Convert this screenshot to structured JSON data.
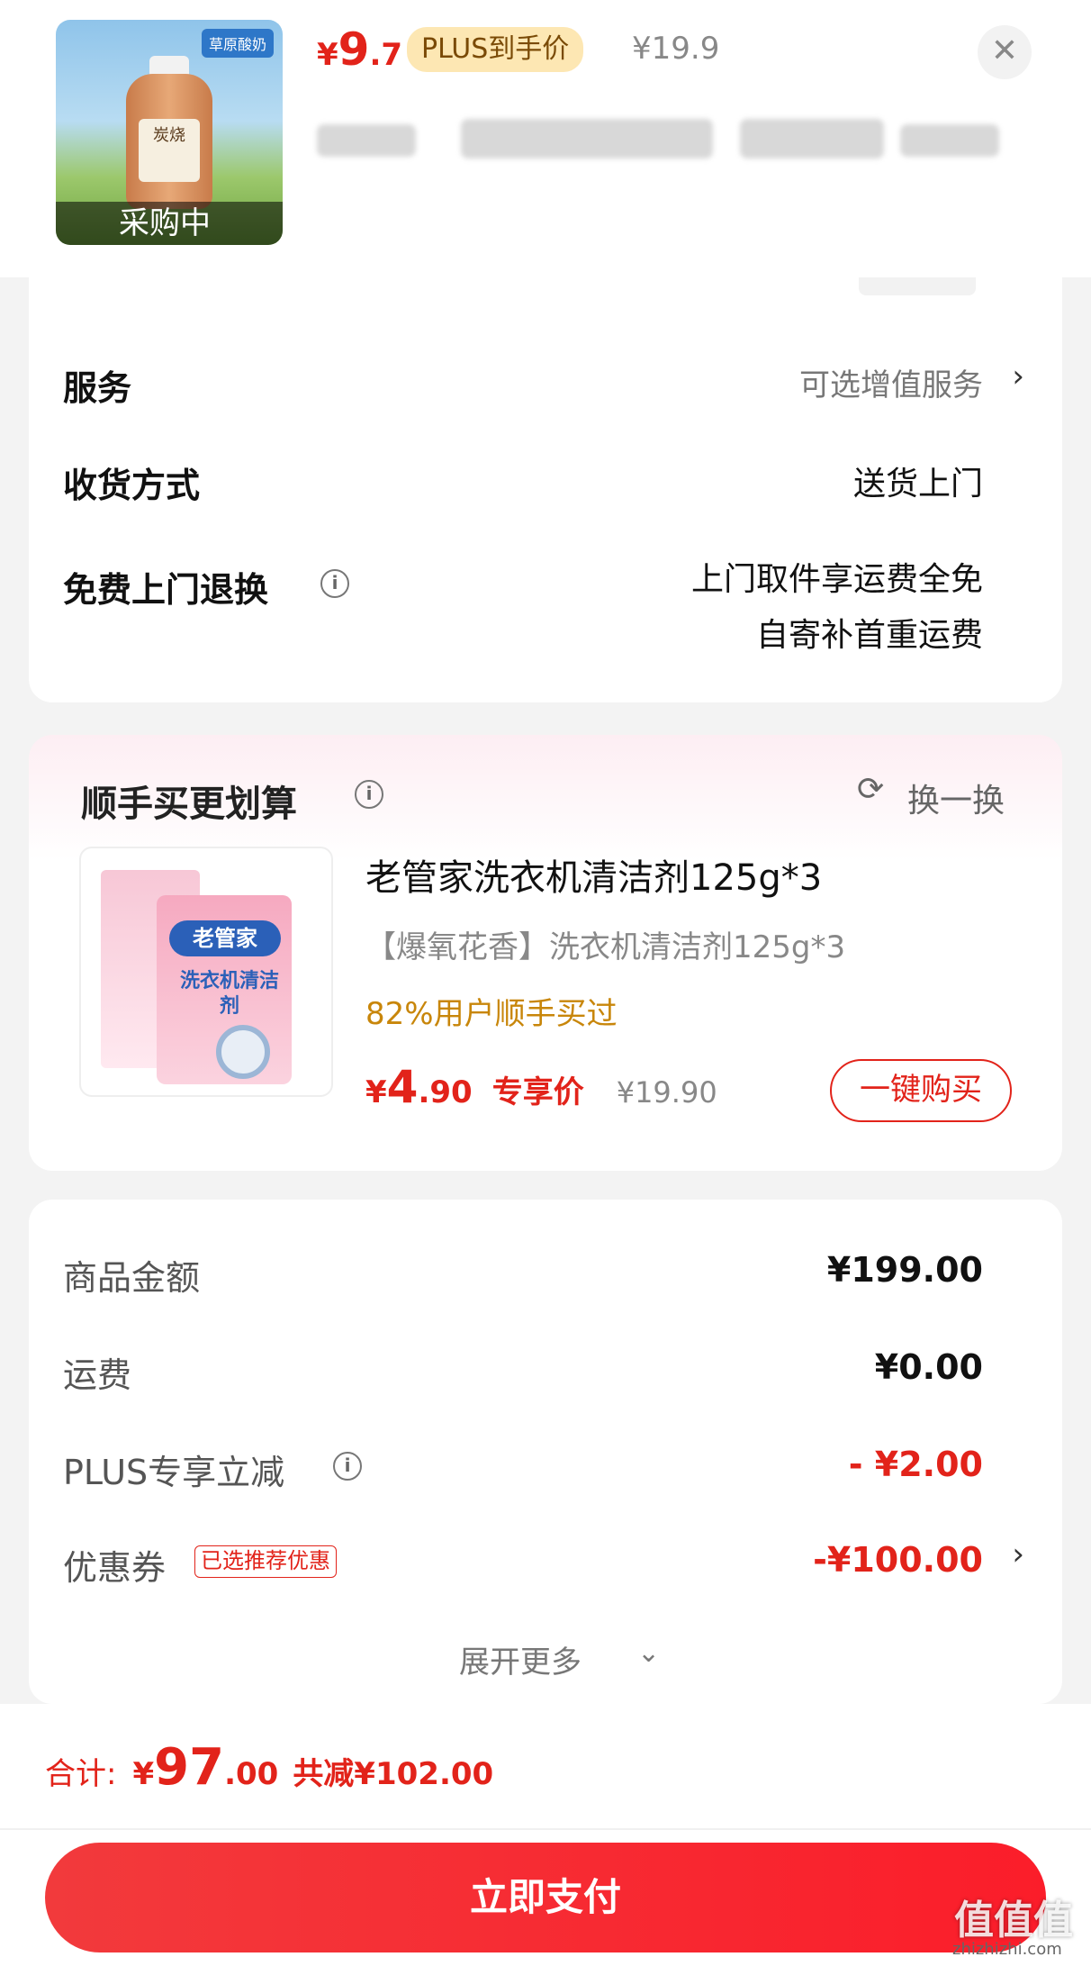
{
  "header": {
    "thumb_status": "采购中",
    "thumb_badge": "草原酸奶",
    "thumb_label": "炭烧",
    "currency": "¥",
    "price_int": "9",
    "price_dec": ".7",
    "plus_tag": "PLUS到手价",
    "orig_price": "¥19.9",
    "close_icon": "close-icon"
  },
  "options": {
    "service_label": "服务",
    "service_value": "可选增值服务",
    "delivery_label": "收货方式",
    "delivery_value": "送货上门",
    "return_label": "免费上门退换",
    "return_line1": "上门取件享运费全免",
    "return_line2": "自寄补首重运费"
  },
  "addon": {
    "title": "顺手买更划算",
    "refresh_label": "换一换",
    "product_name": "老管家洗衣机清洁剂125g*3",
    "product_variant": "【爆氧花香】洗衣机清洁剂125g*3",
    "social_proof": "82%用户顺手买过",
    "currency": "¥",
    "price_int": "4",
    "price_dec": ".90",
    "price_tag": "专享价",
    "orig_price": "¥19.90",
    "buy_button": "一键购买",
    "img_brand": "老管家",
    "img_text": "洗衣机清洁剂"
  },
  "summary": {
    "goods_label": "商品金额",
    "goods_value": "¥199.00",
    "shipping_label": "运费",
    "shipping_value": "¥0.00",
    "plus_label": "PLUS专享立减",
    "plus_value": "- ¥2.00",
    "coupon_label": "优惠券",
    "coupon_tag": "已选推荐优惠",
    "coupon_value": "-¥100.00",
    "expand_label": "展开更多"
  },
  "footer": {
    "total_label": "合计:",
    "currency": "¥",
    "total_int": "97",
    "total_dec": ".00",
    "saved_label": "共减¥102.00",
    "pay_button": "立即支付"
  },
  "watermark": {
    "text": "值值值",
    "url": "zhizhizhi.com"
  },
  "colors": {
    "accent_red": "#e2231a",
    "gold": "#c8860a",
    "plus_tag_bg": "#fde7b3"
  }
}
